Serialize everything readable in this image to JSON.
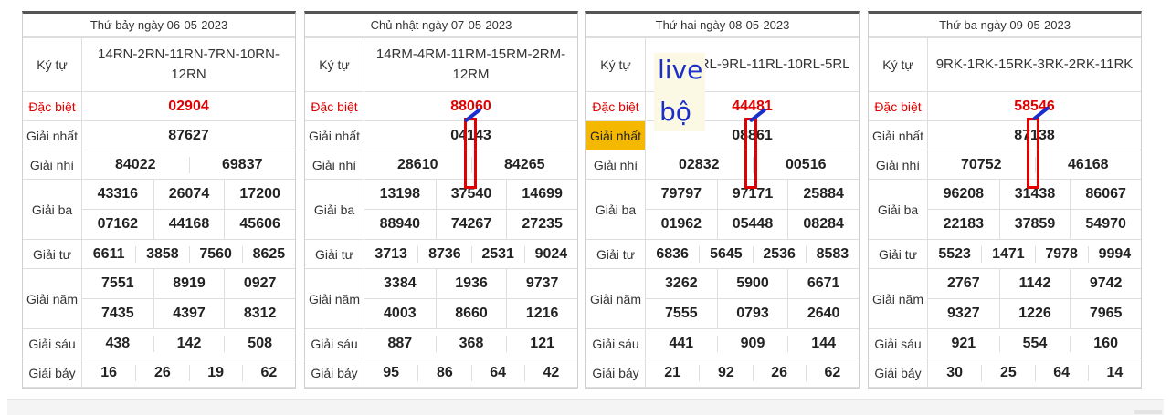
{
  "labels": {
    "kytu": "Ký tự",
    "dacbiet": "Đặc biệt",
    "nhat": "Giải nhất",
    "nhi": "Giải nhì",
    "ba": "Giải ba",
    "tu": "Giải tư",
    "nam": "Giải năm",
    "sau": "Giải sáu",
    "bay": "Giải bảy"
  },
  "cards": [
    {
      "header": "Thứ bảy ngày 06-05-2023",
      "kytu": "14RN-2RN-11RN-7RN-10RN-12RN",
      "dacbiet": "02904",
      "nhat": "87627",
      "nhi": [
        "84022",
        "69837"
      ],
      "ba": [
        "43316",
        "26074",
        "17200",
        "07162",
        "44168",
        "45606"
      ],
      "tu": [
        "6611",
        "3858",
        "7560",
        "8625"
      ],
      "nam": [
        "7551",
        "8919",
        "0927",
        "7435",
        "4397",
        "8312"
      ],
      "sau": [
        "438",
        "142",
        "508"
      ],
      "bay": [
        "16",
        "26",
        "19",
        "62"
      ]
    },
    {
      "header": "Chủ nhật ngày 07-05-2023",
      "kytu": "14RM-4RM-11RM-15RM-2RM-12RM",
      "dacbiet": "88060",
      "nhat": "04143",
      "nhi": [
        "28610",
        "84265"
      ],
      "ba": [
        "13198",
        "37540",
        "14699",
        "88940",
        "74267",
        "27235"
      ],
      "tu": [
        "3713",
        "8736",
        "2531",
        "9024"
      ],
      "nam": [
        "3384",
        "1936",
        "9737",
        "4003",
        "8660",
        "1216"
      ],
      "sau": [
        "887",
        "368",
        "121"
      ],
      "bay": [
        "95",
        "86",
        "64",
        "42"
      ]
    },
    {
      "header": "Thứ hai ngày 08-05-2023",
      "kytu": "2RL-12RL-9RL-11RL-10RL-5RL",
      "dacbiet": "44481",
      "nhat": "08861",
      "nhi": [
        "02832",
        "00516"
      ],
      "ba": [
        "79797",
        "97171",
        "25884",
        "01962",
        "05448",
        "08284"
      ],
      "tu": [
        "6836",
        "5645",
        "2536",
        "8583"
      ],
      "nam": [
        "3262",
        "5900",
        "6671",
        "7555",
        "0793",
        "2640"
      ],
      "sau": [
        "441",
        "909",
        "144"
      ],
      "bay": [
        "21",
        "92",
        "26",
        "62"
      ]
    },
    {
      "header": "Thứ ba ngày 09-05-2023",
      "kytu": "9RK-1RK-15RK-3RK-2RK-11RK",
      "dacbiet": "58546",
      "nhat": "87138",
      "nhi": [
        "70752",
        "46168"
      ],
      "ba": [
        "96208",
        "31438",
        "86067",
        "22183",
        "37859",
        "54970"
      ],
      "tu": [
        "5523",
        "1471",
        "7978",
        "9994"
      ],
      "nam": [
        "2767",
        "1142",
        "9742",
        "9327",
        "1226",
        "7965"
      ],
      "sau": [
        "921",
        "554",
        "160"
      ],
      "bay": [
        "30",
        "25",
        "64",
        "14"
      ]
    }
  ],
  "annotation": {
    "line1": "live",
    "line2": "bộ"
  },
  "colors": {
    "special": "#e00000",
    "highlight": "#f5b800",
    "marker": "#1a2ecc"
  }
}
